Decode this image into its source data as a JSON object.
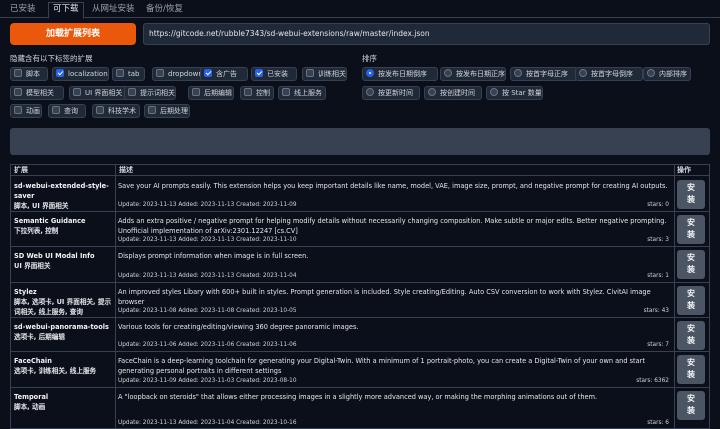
{
  "tabs": [
    "已安装",
    "可下载",
    "从网址安装",
    "备份/恢复"
  ],
  "load_button": "加载扩展列表",
  "url_value": "https://gitcode.net/rubble7343/sd-webui-extensions/raw/master/index.json",
  "hide_label": "隐藏含有以下标签的扩展",
  "sort_label": "排序",
  "filters": [
    {
      "label": "脚本",
      "checked": false
    },
    {
      "label": "localization",
      "checked": true
    },
    {
      "label": "tab",
      "checked": false
    },
    {
      "label": "dropdown",
      "checked": false
    },
    {
      "label": "含广告",
      "checked": true
    },
    {
      "label": "已安装",
      "checked": true
    },
    {
      "label": "训练相关",
      "checked": false
    },
    {
      "label": "模型相关",
      "checked": false
    },
    {
      "label": "UI 界面相关",
      "checked": false
    },
    {
      "label": "提示词相关",
      "checked": false
    },
    {
      "label": "后期编辑",
      "checked": false
    },
    {
      "label": "控制",
      "checked": false
    },
    {
      "label": "线上服务",
      "checked": false
    },
    {
      "label": "动画",
      "checked": false
    },
    {
      "label": "查询",
      "checked": false
    },
    {
      "label": "科技学术",
      "checked": false
    },
    {
      "label": "后期处理",
      "checked": false
    }
  ],
  "sorts": [
    {
      "label": "按发布日期倒序",
      "selected": true
    },
    {
      "label": "按发布日期正序",
      "selected": false
    },
    {
      "label": "按首字母正序",
      "selected": false
    },
    {
      "label": "按首字母倒序",
      "selected": false
    },
    {
      "label": "内部排序",
      "selected": false
    },
    {
      "label": "按更新时间",
      "selected": false
    },
    {
      "label": "按创建时间",
      "selected": false
    },
    {
      "label": "按 Star 数量",
      "selected": false
    }
  ],
  "table": {
    "headers": [
      "扩展",
      "描述",
      "操作"
    ],
    "install_label": "安装",
    "rows": [
      {
        "name": "sd-webui-extended-style-saver",
        "tags": "脚本, UI 界面相关",
        "desc": "Save your AI prompts easily. This extension helps you keep important details like name, model, VAE, image size, prompt, and negative prompt for creating AI outputs.",
        "meta": "Update: 2023-11-13 Added: 2023-11-13 Created: 2023-11-09",
        "stars": "stars: 0"
      },
      {
        "name": "Semantic Guidance",
        "tags": "下拉列表, 控制",
        "desc": "Adds an extra positive / negative prompt for helping modify details without necessarily changing composition. Make subtle or major edits. Better negative prompting. Unofficial implementation of arXiv:2301.12247 [cs.CV]",
        "meta": "Update: 2023-11-13 Added: 2023-11-13 Created: 2023-11-10",
        "stars": "stars: 3"
      },
      {
        "name": "SD Web UI Modal Info",
        "tags": "UI 界面相关",
        "desc": "Displays prompt information when image is in full screen.",
        "meta": "Update: 2023-11-13 Added: 2023-11-13 Created: 2023-11-04",
        "stars": "stars: 1"
      },
      {
        "name": "Stylez",
        "tags": "脚本, 选项卡, UI 界面相关, 提示词相关, 线上服务, 查询",
        "desc": "An improved styles Libary with 600+ built in styles. Prompt generation is included. Style creating/Editing. Auto CSV conversion to work with Stylez. CivitAI image browser",
        "meta": "Update: 2023-11-08 Added: 2023-11-08 Created: 2023-10-05",
        "stars": "stars: 43"
      },
      {
        "name": "sd-webui-panorama-tools",
        "tags": "选项卡, 后期编辑",
        "desc": "Various tools for creating/editing/viewing 360 degree panoramic images.",
        "meta": "Update: 2023-11-06 Added: 2023-11-06 Created: 2023-11-06",
        "stars": "stars: 7"
      },
      {
        "name": "FaceChain",
        "tags": "选项卡, 训练相关, 线上服务",
        "desc": "FaceChain is a deep-learning toolchain for generating your Digital-Twin. With a minimum of 1 portrait-photo, you can create a Digital-Twin of your own and start generating personal portraits in different settings",
        "meta": "Update: 2023-11-09 Added: 2023-11-03 Created: 2023-08-10",
        "stars": "stars: 6362"
      },
      {
        "name": "Temporal",
        "tags": "脚本, 动画",
        "desc": "A \"loopback on steroids\" that allows either processing images in a slightly more advanced way, or making the morphing animations out of them.",
        "meta": "Update: 2023-11-13 Added: 2023-11-04 Created: 2023-10-16",
        "stars": "stars: 6"
      }
    ]
  }
}
